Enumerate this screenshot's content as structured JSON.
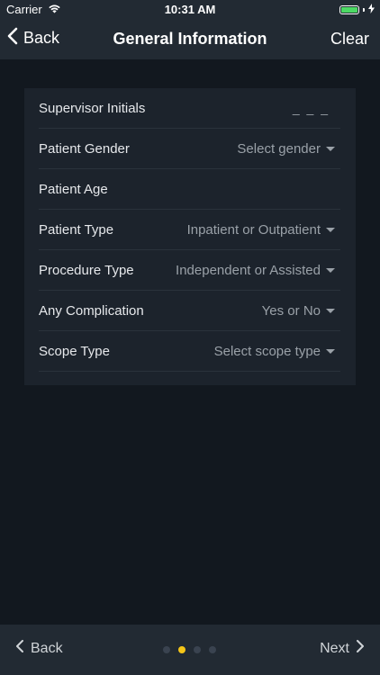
{
  "status_bar": {
    "carrier": "Carrier",
    "time": "10:31 AM"
  },
  "nav": {
    "back_label": "Back",
    "title": "General Information",
    "clear_label": "Clear"
  },
  "form": {
    "rows": [
      {
        "label": "Supervisor Initials",
        "value": "_ _ _"
      },
      {
        "label": "Patient Gender",
        "value": "Select gender"
      },
      {
        "label": "Patient Age",
        "value": ""
      },
      {
        "label": "Patient Type",
        "value": "Inpatient or Outpatient"
      },
      {
        "label": "Procedure Type",
        "value": "Independent or Assisted"
      },
      {
        "label": "Any Complication",
        "value": "Yes or No"
      },
      {
        "label": "Scope Type",
        "value": "Select scope type"
      }
    ]
  },
  "bottom": {
    "back_label": "Back",
    "next_label": "Next",
    "page_count": 4,
    "current_page": 2
  },
  "colors": {
    "accent": "#f5c518",
    "battery": "#4cd964",
    "background": "#12181f"
  }
}
